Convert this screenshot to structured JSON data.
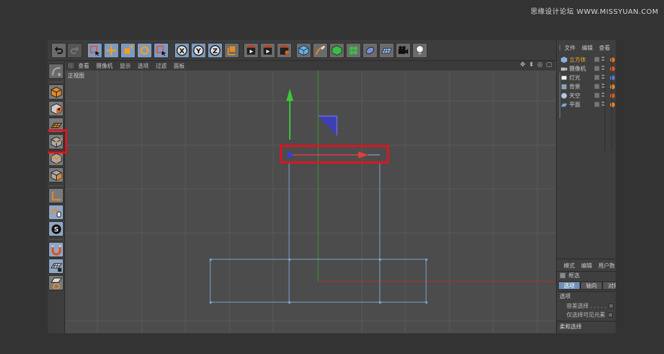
{
  "watermark": "思缘设计论坛 WWW.MISSYUAN.COM",
  "viewport": {
    "menu": [
      "查看",
      "摄像机",
      "显示",
      "选项",
      "过滤",
      "面板"
    ],
    "nav_glyphs": "✥ ⬍ ◎ ▢",
    "view_label": "正视图"
  },
  "object_manager": {
    "menu": [
      "文件",
      "编辑",
      "查看"
    ],
    "items": [
      {
        "label": "立方体",
        "selected": true,
        "icon_color": "#8ab0d8"
      },
      {
        "label": "摄像机",
        "selected": false,
        "icon_color": "#9a9a9a"
      },
      {
        "label": "灯光",
        "selected": false,
        "icon_color": "#e8e8e8"
      },
      {
        "label": "背景",
        "selected": false,
        "icon_color": "#8aa0b8"
      },
      {
        "label": "天空",
        "selected": false,
        "icon_color": "#b0c8e0"
      },
      {
        "label": "平面",
        "selected": false,
        "icon_color": "#7aa8d0"
      }
    ]
  },
  "attributes": {
    "menu": [
      "模式",
      "编辑",
      "用户数"
    ],
    "title": "框选",
    "tabs": [
      "选项",
      "轴向",
      "对象"
    ],
    "section": "选项",
    "rows": [
      "容差选择 . . . . .",
      "仅选择可见元素"
    ],
    "section2": "柔和选择"
  },
  "colors": {
    "accent_orange": "#f0a830",
    "axis_green": "#3cc83c",
    "axis_red": "#e03c3c",
    "axis_blue": "#3c3cc8",
    "highlight_red": "#e0141e",
    "edge_blue": "#7aa6d0"
  },
  "icons": {
    "top_toolbar": [
      "undo-icon",
      "redo-icon",
      "live-select-icon",
      "move-icon",
      "scale-icon",
      "rotate-icon",
      "recent-tool-icon",
      "x-axis-icon",
      "y-axis-icon",
      "z-axis-icon",
      "coordinate-system-icon",
      "render-view-icon",
      "render-picture-queue-icon",
      "render-settings-icon",
      "cube-primitive-icon",
      "pen-spline-icon",
      "subdivision-icon",
      "array-icon",
      "deformer-icon",
      "floor-icon",
      "camera-icon",
      "light-icon"
    ],
    "left_toolbar": [
      "make-editable-icon",
      "model-mode-icon",
      "texture-mode-icon",
      "workplane-icon",
      "points-mode-icon",
      "edges-mode-icon",
      "polygons-mode-icon",
      "axis-mode-icon",
      "tweak-mode-icon",
      "solo-mode-icon",
      "magnet-icon",
      "snap-icon",
      "lock-workplane-icon"
    ]
  }
}
